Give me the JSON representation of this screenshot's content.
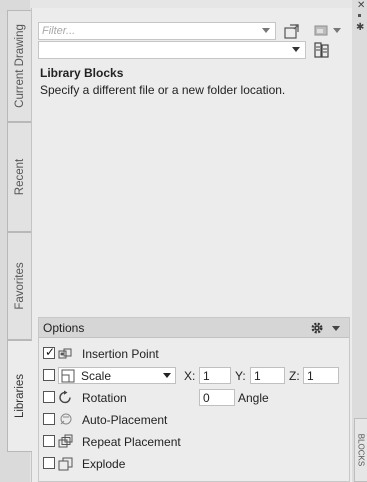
{
  "tabs": [
    {
      "label": "Current Drawing",
      "active": false
    },
    {
      "label": "Recent",
      "active": false
    },
    {
      "label": "Favorites",
      "active": false
    },
    {
      "label": "Libraries",
      "active": true
    }
  ],
  "toolbar": {
    "filter_placeholder": "Filter...",
    "library_path_value": "",
    "icons": [
      "import-block-icon",
      "thumbnail-view-icon",
      "chevron-down-icon",
      "library-browse-icon"
    ]
  },
  "library": {
    "heading": "Library Blocks",
    "description": "Specify a different file or a new folder location."
  },
  "options": {
    "title": "Options",
    "settings_icon": "gear-icon",
    "insertion_point": {
      "label": "Insertion Point",
      "checked": true
    },
    "scale": {
      "checked": false,
      "mode": "Scale",
      "x_label": "X:",
      "x": "1",
      "y_label": "Y:",
      "y": "1",
      "z_label": "Z:",
      "z": "1"
    },
    "rotation": {
      "label": "Rotation",
      "checked": false,
      "value": "0",
      "unit_label": "Angle"
    },
    "auto_placement": {
      "label": "Auto-Placement",
      "checked": false
    },
    "repeat_placement": {
      "label": "Repeat Placement",
      "checked": false
    },
    "explode": {
      "label": "Explode",
      "checked": false
    }
  },
  "side_panel": {
    "label": "BLOCKS"
  },
  "colors": {
    "panel_bg": "#ececec",
    "header_bg": "#d6d6d6",
    "border": "#c4c4c4"
  }
}
